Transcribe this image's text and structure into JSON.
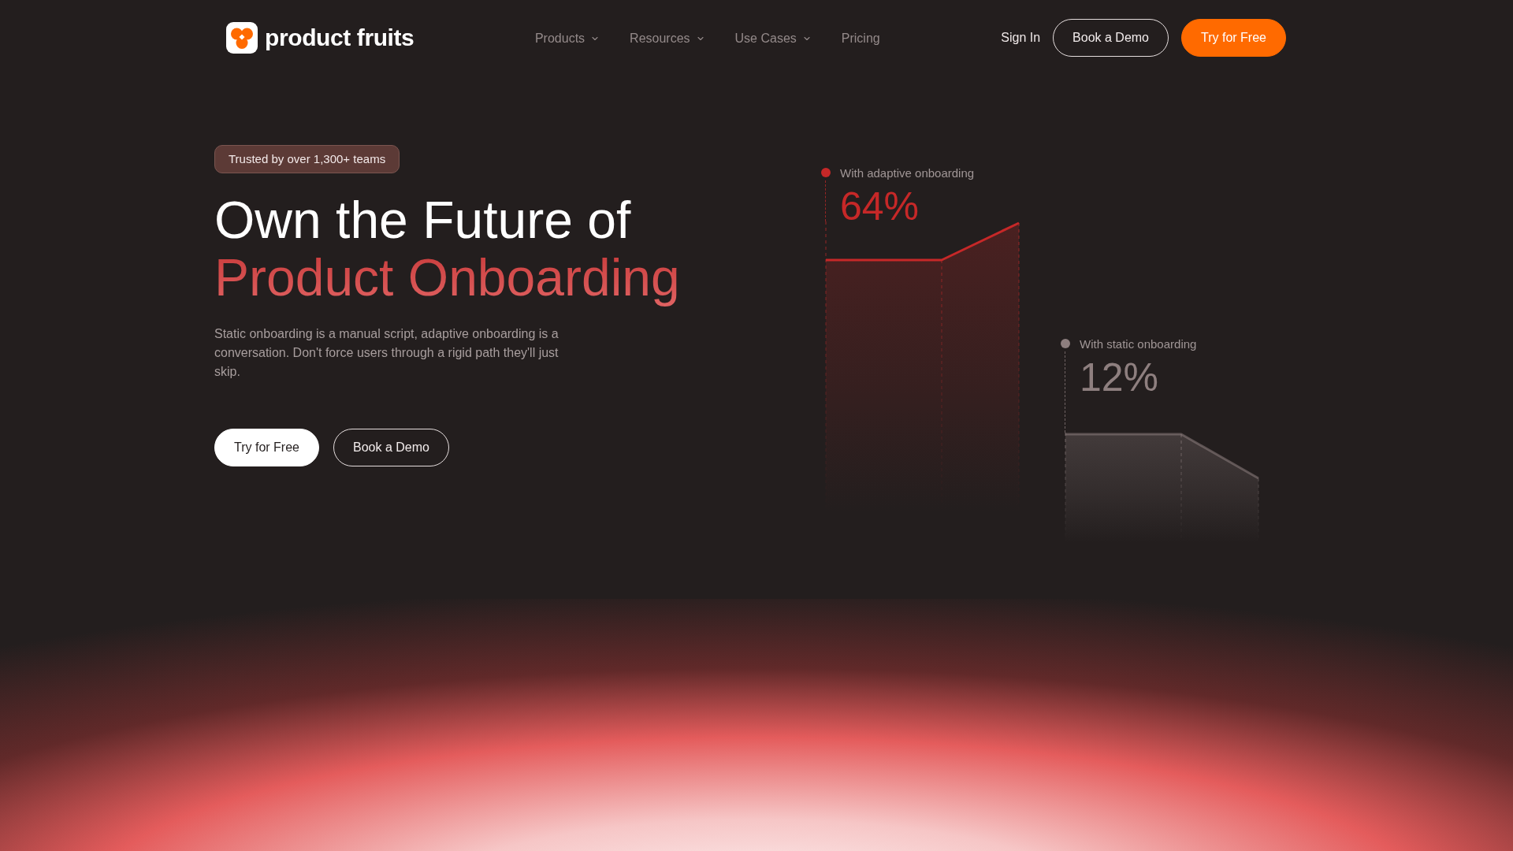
{
  "header": {
    "brand": "product fruits",
    "nav": [
      {
        "label": "Products",
        "dropdown": true
      },
      {
        "label": "Resources",
        "dropdown": true
      },
      {
        "label": "Use Cases",
        "dropdown": true
      },
      {
        "label": "Pricing",
        "dropdown": false
      }
    ],
    "sign_in": "Sign In",
    "buttons": [
      {
        "label": "Book a Demo",
        "kind": "outline"
      },
      {
        "label": "Try for Free",
        "kind": "primary"
      }
    ]
  },
  "hero": {
    "badge": "Trusted by over 1,300+ teams",
    "title": "Own the Future of",
    "title_highlight": "Product Onboarding",
    "description": "Static onboarding is a manual script, adaptive onboarding is a conversation. Don't force users through a rigid path they'll just skip.",
    "buttons": [
      {
        "label": "Try for Free",
        "kind": "light"
      },
      {
        "label": "Book a Demo",
        "kind": "outline"
      }
    ]
  },
  "comparison": [
    {
      "label": "With adaptive onboarding",
      "value": "64%",
      "color": "#c62828",
      "kind": "rising"
    },
    {
      "label": "With static onboarding",
      "value": "12%",
      "color": "#8e7f7f",
      "kind": "falling"
    }
  ]
}
